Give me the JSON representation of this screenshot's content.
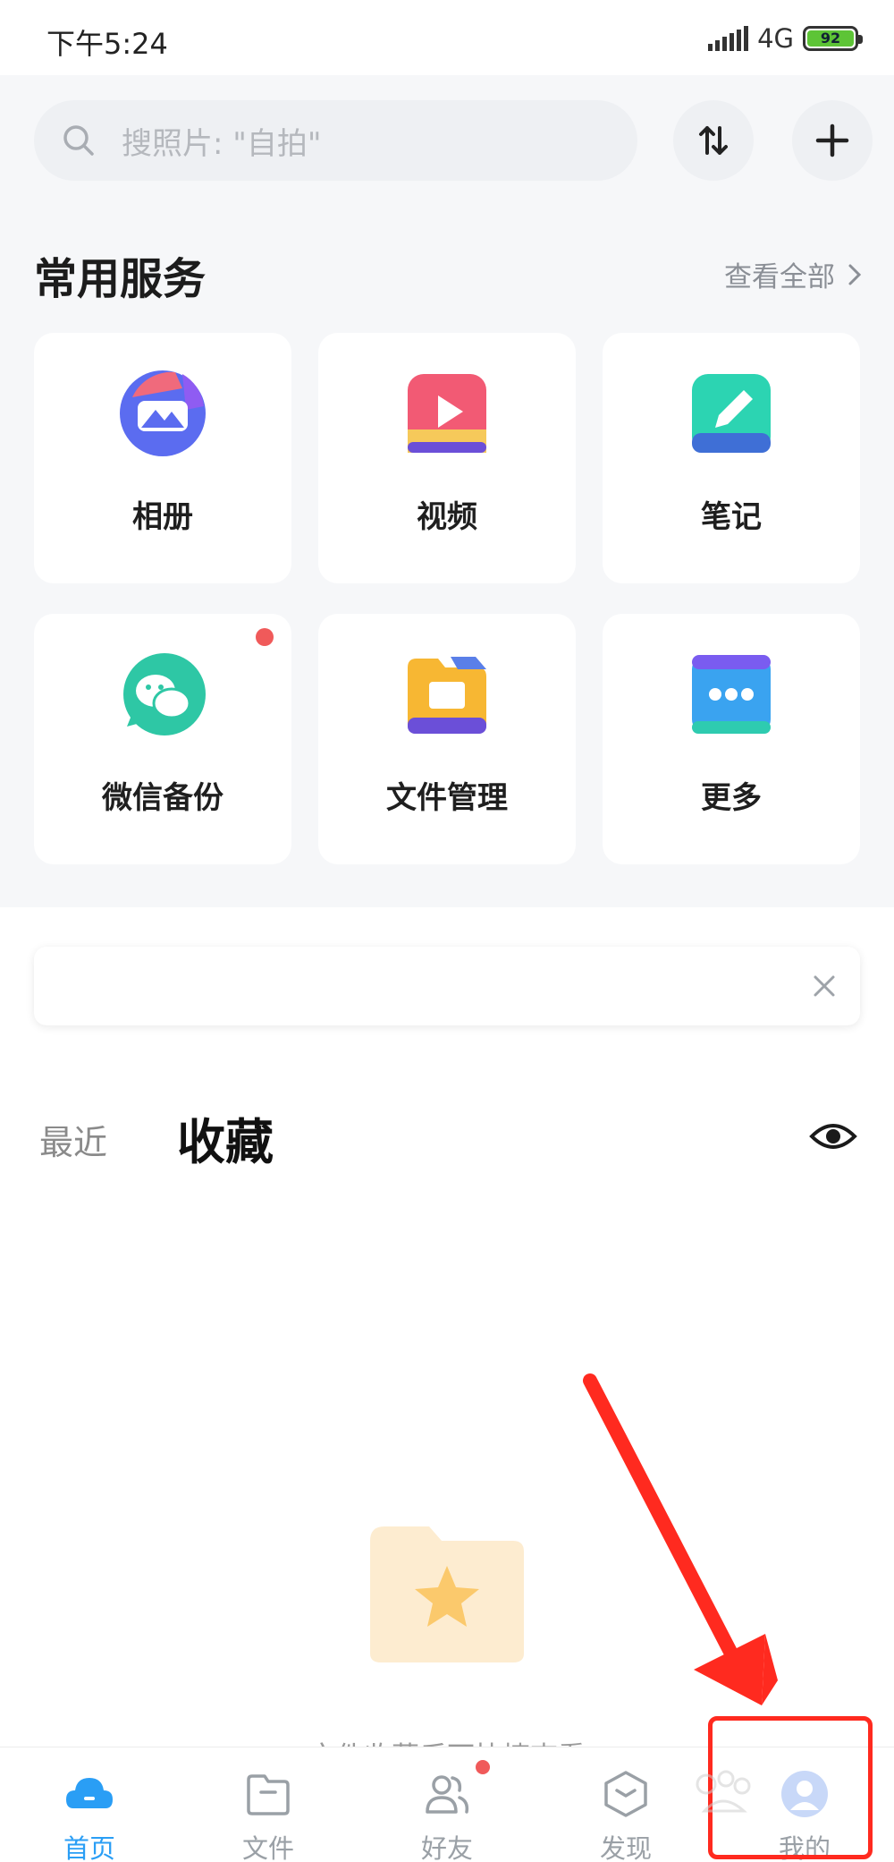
{
  "status_bar": {
    "time": "下午5:24",
    "network": "4G",
    "battery": "92",
    "battery_color": "#5dc436"
  },
  "search": {
    "placeholder": "搜照片: \"自拍\"",
    "icon": "search-icon"
  },
  "header_buttons": {
    "sort_icon": "sort-arrows-icon",
    "add_icon": "plus-icon"
  },
  "services": {
    "title": "常用服务",
    "view_all": "查看全部",
    "items": [
      {
        "label": "相册",
        "icon": "album-icon"
      },
      {
        "label": "视频",
        "icon": "video-icon"
      },
      {
        "label": "笔记",
        "icon": "note-icon"
      },
      {
        "label": "微信备份",
        "icon": "wechat-backup-icon",
        "badge": true
      },
      {
        "label": "文件管理",
        "icon": "file-manager-icon"
      },
      {
        "label": "更多",
        "icon": "more-icon"
      }
    ]
  },
  "content_tabs": {
    "recent": "最近",
    "favorites": "收藏",
    "eye_icon": "eye-icon"
  },
  "empty_state": {
    "icon": "star-folder-icon",
    "text": "文件收藏后可快捷查看"
  },
  "bottom_nav": {
    "active_color": "#2a9ef5",
    "items": [
      {
        "label": "首页",
        "icon": "home-cloud-icon",
        "active": true
      },
      {
        "label": "文件",
        "icon": "folder-icon"
      },
      {
        "label": "好友",
        "icon": "friends-icon",
        "badge": true
      },
      {
        "label": "发现",
        "icon": "discover-icon"
      },
      {
        "label": "我的",
        "icon": "profile-avatar-icon"
      }
    ]
  },
  "annotation": {
    "color": "#ff2a1f"
  }
}
